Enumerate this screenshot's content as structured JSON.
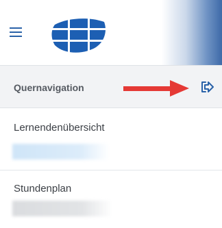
{
  "header": {
    "menu_icon": "hamburger-menu-icon",
    "logo_icon": "school-logo-icon",
    "accent_color": "#2a62a8"
  },
  "nav": {
    "quernavigation": {
      "label": "Quernavigation",
      "action_icon": "exit-arrow-icon",
      "annotation_icon": "red-arrow-icon",
      "annotation_color": "#e53935"
    },
    "items": [
      {
        "label": "Lernendenübersicht"
      },
      {
        "label": "Stundenplan"
      }
    ]
  }
}
